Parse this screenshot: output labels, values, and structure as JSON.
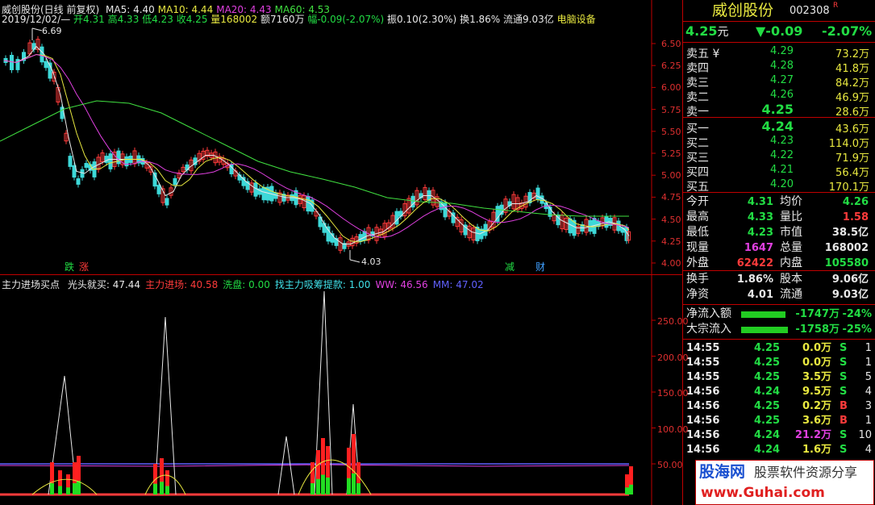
{
  "chart": {
    "info_bar": {
      "date": "2019/12/02/—",
      "open": "开4.31",
      "high": "高4.33",
      "low": "低4.23",
      "close": "收4.25",
      "volume": "量168002",
      "amount": "额7160万",
      "change": "幅-0.09(-2.07%)",
      "amplitude": "振0.10(2.30%)",
      "turnover": "换1.86%",
      "float": "流通9.03亿",
      "sector": "电脑设备"
    },
    "title": "威创股份(日线 前复权)",
    "ma": [
      {
        "label": "MA5: 4.40",
        "color": "#e8e8e8"
      },
      {
        "label": "MA10: 4.44",
        "color": "#e8e840"
      },
      {
        "label": "MA20: 4.43",
        "color": "#e040e0"
      },
      {
        "label": "MA60: 4.53",
        "color": "#40e040"
      }
    ],
    "price_axis": [
      "6.50",
      "6.25",
      "6.00",
      "5.75",
      "5.50",
      "5.25",
      "5.00",
      "4.75",
      "4.50",
      "4.25",
      "4.00"
    ],
    "annotations": {
      "high_label": "6.69",
      "low_label": "4.03"
    },
    "markers": [
      {
        "text": "跌",
        "color": "#22dd44"
      },
      {
        "text": "涨",
        "color": "#ff3b3b"
      },
      {
        "text": "减",
        "color": "#22dd44"
      },
      {
        "text": "财",
        "color": "#40a0ff"
      }
    ]
  },
  "indicator": {
    "name": "主力进场买点",
    "items": [
      {
        "label": "光头就买: 47.44",
        "color": "#e8e8e8"
      },
      {
        "label": "主力进场: 40.58",
        "color": "#ff3b3b"
      },
      {
        "label": "洗盘: 0.00",
        "color": "#22dd44"
      },
      {
        "label": "找主力吸筹提款: 1.00",
        "color": "#40e0e8"
      },
      {
        "label": "WW: 46.56",
        "color": "#e040e0"
      },
      {
        "label": "MM: 47.02",
        "color": "#6060ff"
      }
    ],
    "axis": [
      "250.00",
      "200.00",
      "150.00",
      "100.00",
      "50.00"
    ]
  },
  "quote": {
    "name": "威创股份",
    "code": "002308",
    "flag": "R",
    "price": "4.25",
    "price_unit": "元",
    "change": "▼-0.09",
    "change_pct": "-2.07%",
    "asks": [
      {
        "label": "卖五",
        "mark": "¥",
        "price": "4.29",
        "vol": "73.2万"
      },
      {
        "label": "卖四",
        "mark": "",
        "price": "4.28",
        "vol": "41.8万"
      },
      {
        "label": "卖三",
        "mark": "",
        "price": "4.27",
        "vol": "84.2万"
      },
      {
        "label": "卖二",
        "mark": "",
        "price": "4.26",
        "vol": "46.9万"
      },
      {
        "label": "卖一",
        "mark": "",
        "price": "4.25",
        "vol": "28.6万"
      }
    ],
    "bids": [
      {
        "label": "买一",
        "price": "4.24",
        "vol": "43.6万"
      },
      {
        "label": "买二",
        "price": "4.23",
        "vol": "114.0万"
      },
      {
        "label": "买三",
        "price": "4.22",
        "vol": "71.9万"
      },
      {
        "label": "买四",
        "price": "4.21",
        "vol": "56.4万"
      },
      {
        "label": "买五",
        "price": "4.20",
        "vol": "170.1万"
      }
    ],
    "stats": [
      {
        "l1": "今开",
        "v1": "4.31",
        "c1": "down",
        "l2": "均价",
        "v2": "4.26",
        "c2": "down"
      },
      {
        "l1": "最高",
        "v1": "4.33",
        "c1": "down",
        "l2": "量比",
        "v2": "1.58",
        "c2": "up"
      },
      {
        "l1": "最低",
        "v1": "4.23",
        "c1": "down",
        "l2": "市值",
        "v2": "38.5亿",
        "c2": "wht"
      },
      {
        "l1": "现量",
        "v1": "1647",
        "c1": "mag",
        "l2": "总量",
        "v2": "168002",
        "c2": "wht"
      },
      {
        "l1": "外盘",
        "v1": "62422",
        "c1": "up",
        "l2": "内盘",
        "v2": "105580",
        "c2": "down"
      }
    ],
    "stats2": [
      {
        "l1": "换手",
        "v1": "1.86%",
        "l2": "股本",
        "v2": "9.06亿"
      },
      {
        "l1": "净资",
        "v1": "4.01",
        "l2": "流通",
        "v2": "9.03亿"
      }
    ],
    "flows": [
      {
        "label": "净流入额",
        "value": "-1747万",
        "pct": "-24%",
        "fill": 0.24
      },
      {
        "label": "大宗流入",
        "value": "-1758万",
        "pct": "-25%",
        "fill": 0.25
      }
    ],
    "ticks": [
      {
        "time": "14:55",
        "price": "4.25",
        "vol": "0.0万",
        "vc": "yel",
        "side": "S",
        "n": "1"
      },
      {
        "time": "14:55",
        "price": "4.25",
        "vol": "0.0万",
        "vc": "yel",
        "side": "S",
        "n": "1"
      },
      {
        "time": "14:55",
        "price": "4.25",
        "vol": "3.5万",
        "vc": "yel",
        "side": "S",
        "n": "5"
      },
      {
        "time": "14:56",
        "price": "4.24",
        "vol": "9.5万",
        "vc": "yel",
        "side": "S",
        "n": "4"
      },
      {
        "time": "14:56",
        "price": "4.25",
        "vol": "0.2万",
        "vc": "yel",
        "side": "B",
        "n": "3"
      },
      {
        "time": "14:56",
        "price": "4.25",
        "vol": "3.6万",
        "vc": "yel",
        "side": "B",
        "n": "1"
      },
      {
        "time": "14:56",
        "price": "4.24",
        "vol": "21.2万",
        "vc": "mag",
        "side": "S",
        "n": "10"
      },
      {
        "time": "14:56",
        "price": "4.24",
        "vol": "1.6万",
        "vc": "yel",
        "side": "S",
        "n": "4"
      }
    ]
  },
  "watermark": {
    "brand": "股海网",
    "slogan": "股票软件资源分享",
    "url": "www.Guhai.com"
  }
}
